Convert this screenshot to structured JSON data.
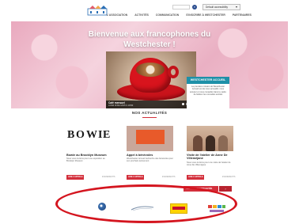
{
  "header": {
    "search_placeholder": "",
    "search_icon": "magnifier-icon",
    "accessibility_label": "Default accessibility",
    "accessibility_chevron": "▾"
  },
  "nav": [
    "L'ASSOCIATION",
    "ACTIVITÉS",
    "COMMUNICATION",
    "S'INSCRIRE À WESTCHESTER",
    "PARTENAIRES"
  ],
  "hero": {
    "title_line1": "Bienvenue aux francophones du",
    "title_line2": "Westchester !",
    "caption_title": "Café mensuel",
    "caption_sub": "LUNDI 18 MAI 2015 À 11H30",
    "side_heading": "WESTCHESTER ACCUEIL",
    "side_text": "La première mission de Westchester Accueil est de nous accueillir, nous écouter et nous conseiller dans le cadre de fédérer les nouvelles amitiés",
    "slides": 4,
    "active_slide": 1
  },
  "news": {
    "heading": "NOS ACTUALITÉS",
    "cards": [
      {
        "title": "Bowie au Brooklyn Museum",
        "text": "Nous vous invitons pour une exposition au Brooklyn Museum",
        "button": "LIRE L'ARTICLE",
        "meta": "EVENEMENTS"
      },
      {
        "title": "Appel à bénévoles",
        "text": "Westchester Accueil recherche des bénévoles pour son prochain événement",
        "button": "LIRE L'ARTICLE",
        "meta": "EVENEMENTS"
      },
      {
        "title": "Visite de l'atelier de Anne De Villeméjane",
        "text": "Nous vous invitons pour une visite de l'atelier de Anne De Villeméjane",
        "button": "LIRE L'ARTICLE",
        "meta": "EVENEMENTS"
      }
    ],
    "more_label": "TOUTES LES ACTUALITÉS",
    "more_arrow": "›"
  },
  "partners": {
    "logo1_caption": ""
  },
  "colors": {
    "accent": "#d32f3b",
    "teal": "#1e90a8",
    "highlight": "#d4151f"
  }
}
